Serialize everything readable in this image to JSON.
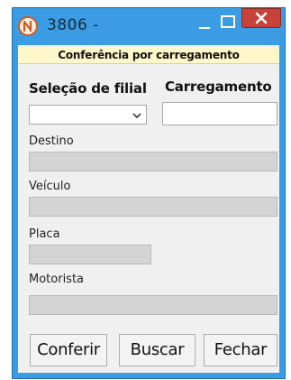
{
  "window": {
    "title": "3806 -",
    "app_icon": "app-logo-icon",
    "controls": {
      "minimize": "minimize-icon",
      "maximize": "maximize-icon",
      "close": "close-icon"
    }
  },
  "header": {
    "text": "Conferência por carregamento"
  },
  "filial": {
    "label": "Seleção de filial",
    "value": ""
  },
  "carregamento": {
    "label": "Carregamento",
    "value": ""
  },
  "destino": {
    "label": "Destino",
    "value": ""
  },
  "veiculo": {
    "label": "Veículo",
    "value": ""
  },
  "placa": {
    "label": "Placa",
    "value": ""
  },
  "motorista": {
    "label": "Motorista",
    "value": ""
  },
  "buttons": {
    "conferir": "Conferir",
    "buscar": "Buscar",
    "fechar": "Fechar"
  },
  "colors": {
    "titlebar": "#3b9ce3",
    "header_band": "#fdf7c9",
    "close_button": "#c7433a",
    "disabled_field": "#d4d4d4"
  }
}
